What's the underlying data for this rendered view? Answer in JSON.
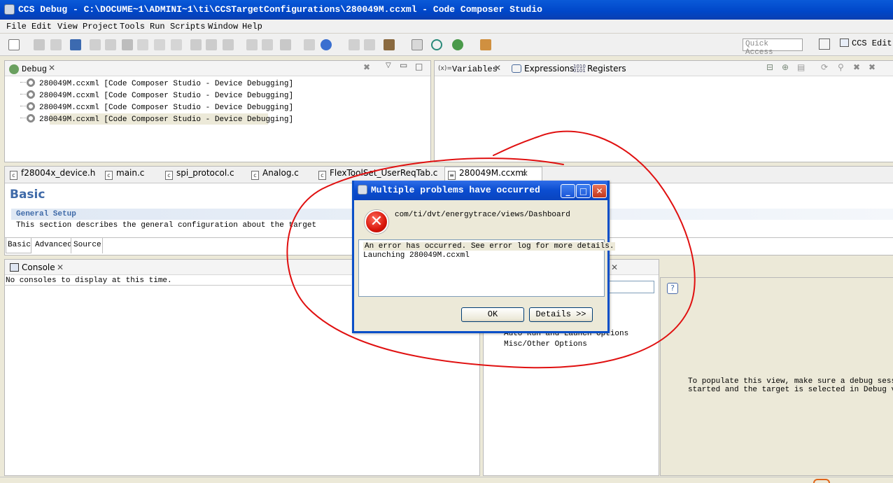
{
  "window": {
    "title": "CCS Debug - C:\\DOCUME~1\\ADMINI~1\\ti\\CCSTargetConfigurations\\280049M.ccxml - Code Composer Studio"
  },
  "menu": [
    "File",
    "Edit",
    "View",
    "Project",
    "Tools",
    "Run",
    "Scripts",
    "Window",
    "Help"
  ],
  "toolbar": {
    "quick_access_placeholder": "Quick Access",
    "perspective_label": "CCS Edit"
  },
  "debug_view": {
    "tab_label": "Debug",
    "items": [
      "280049M.ccxml [Code Composer Studio - Device Debugging]",
      "280049M.ccxml [Code Composer Studio - Device Debugging]",
      "280049M.ccxml [Code Composer Studio - Device Debugging]",
      "280049M.ccxml [Code Composer Studio - Device Debugging]"
    ]
  },
  "vars_view": {
    "tabs": [
      "Variables",
      "Expressions",
      "Registers"
    ]
  },
  "editor": {
    "tabs": [
      "f28004x_device.h",
      "main.c",
      "spi_protocol.c",
      "Analog.c",
      "FlexToolSet_UserReqTab.c",
      "280049M.ccxml"
    ],
    "heading": "Basic",
    "section_title": "General Setup",
    "section_desc": "This section describes the general configuration about the target",
    "bottom_tabs": [
      "Basic",
      "Advanced",
      "Source"
    ]
  },
  "console": {
    "tab_label": "Console",
    "message": "No consoles to display at this time."
  },
  "options_tree": {
    "items": [
      "Auto Run and Launch Options",
      "Misc/Other Options"
    ]
  },
  "hint_view": {
    "text_line1": "To populate this view, make sure a debug session",
    "text_line2": "started and the target is selected in Debug view."
  },
  "dialog": {
    "title": "Multiple problems have occurred",
    "message": "com/ti/dvt/energytrace/views/Dashboard",
    "details_line1": "An error has occurred. See error log for more details.",
    "details_line2": "Launching 280049M.ccxml",
    "ok_label": "OK",
    "details_label": "Details >>"
  },
  "colors": {
    "title_bar": "#0046c8",
    "annotation": "#e01010",
    "error_icon": "#d8150a"
  }
}
